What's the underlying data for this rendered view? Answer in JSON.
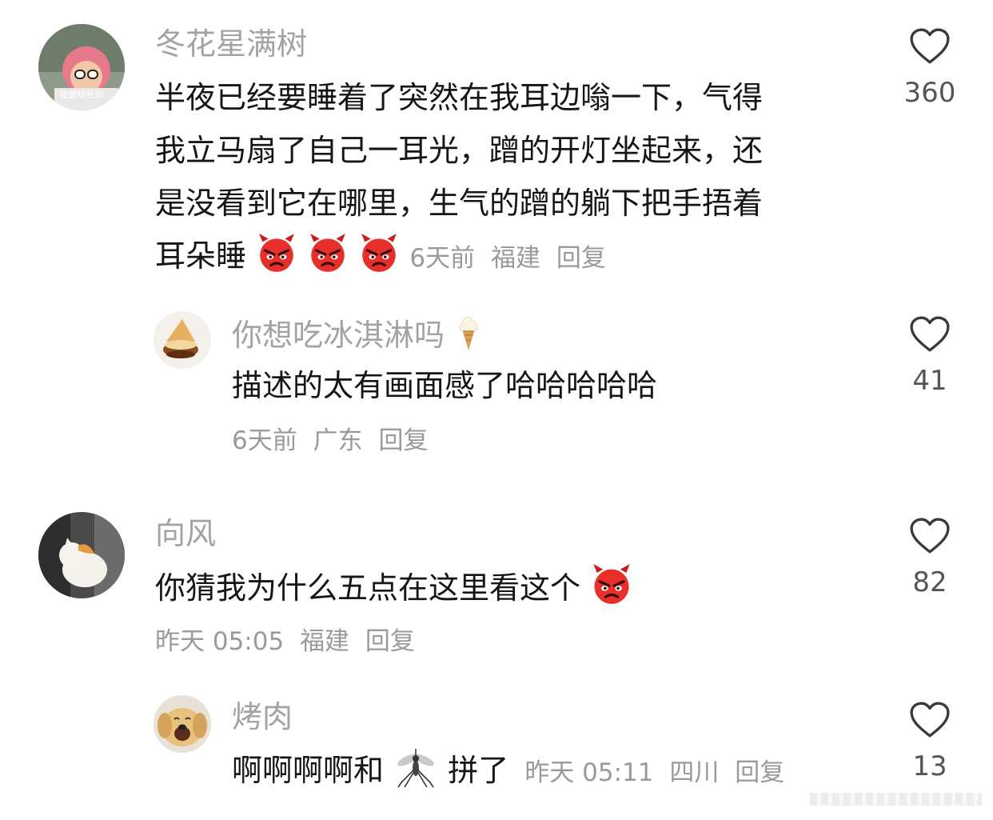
{
  "comments": [
    {
      "username": "冬花星满树",
      "avatar_text": "我要喷死你",
      "text_lines": [
        "半夜已经要睡着了突然在我耳边嗡一下，气得",
        "我立马扇了自己一耳光，蹭的开灯坐起来，还",
        "是没看到它在哪里，生气的蹭的躺下把手捂着",
        "耳朵睡"
      ],
      "emoji": "angry-devil",
      "emoji_count": 3,
      "time": "6天前",
      "location": "福建",
      "reply_label": "回复",
      "likes": "360"
    },
    {
      "username": "你想吃冰淇淋吗",
      "name_emoji": "ice-cream",
      "text": "描述的太有画面感了哈哈哈哈哈",
      "time": "6天前",
      "location": "广东",
      "reply_label": "回复",
      "likes": "41"
    },
    {
      "username": "向风",
      "text": "你猜我为什么五点在这里看这个",
      "emoji": "angry-devil",
      "time": "昨天 05:05",
      "location": "福建",
      "reply_label": "回复",
      "likes": "82"
    },
    {
      "username": "烤肉",
      "text_before": "啊啊啊啊和",
      "inline_emoji": "mosquito",
      "text_after": "拼了",
      "time": "昨天 05:11",
      "location": "四川",
      "reply_label": "回复",
      "likes": "13"
    }
  ],
  "icons": {
    "like": "heart-outline-icon"
  },
  "colors": {
    "text": "#161616",
    "meta": "#9a9a9a",
    "name": "#a3a3a3",
    "emoji_red": "#e8302a"
  }
}
